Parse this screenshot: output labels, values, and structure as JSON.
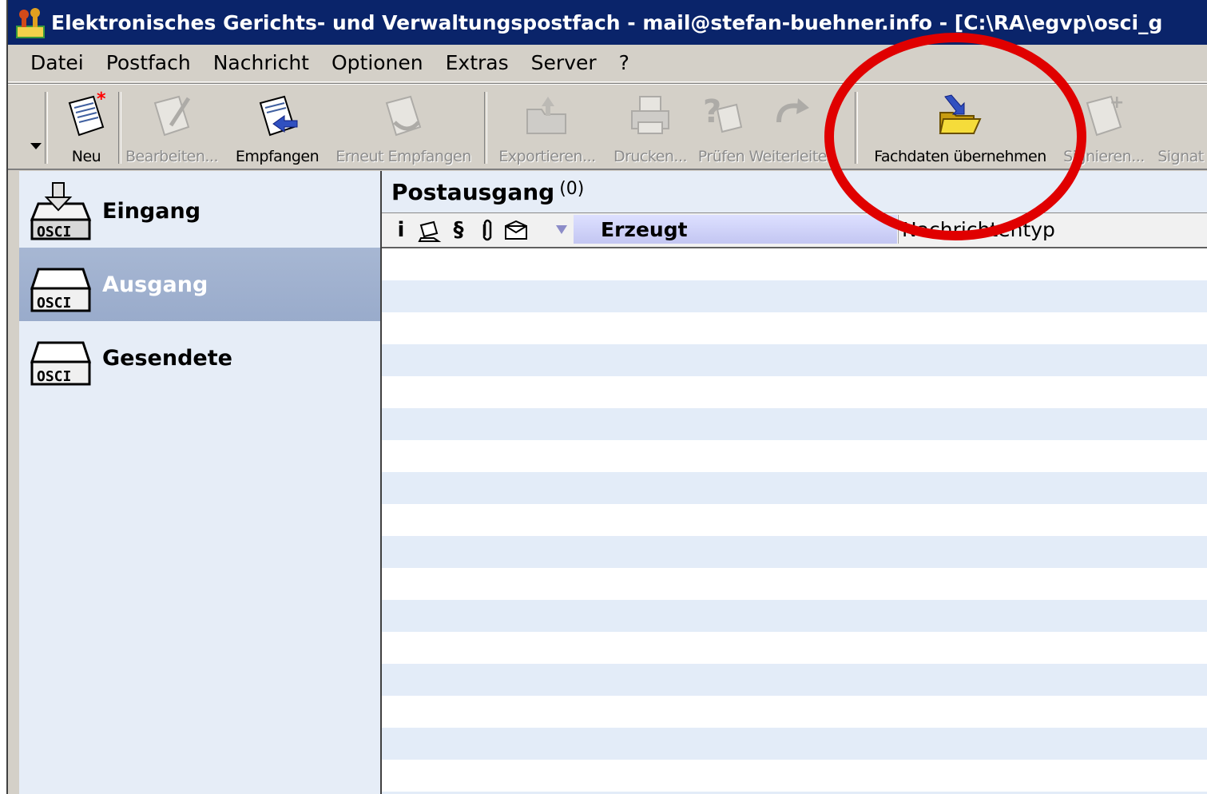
{
  "window": {
    "title": "Elektronisches Gerichts- und Verwaltungspostfach - mail@stefan-buehner.info - [C:\\RA\\egvp\\osci_g"
  },
  "menu": [
    {
      "label": "Datei"
    },
    {
      "label": "Postfach"
    },
    {
      "label": "Nachricht"
    },
    {
      "label": "Optionen"
    },
    {
      "label": "Extras"
    },
    {
      "label": "Server"
    },
    {
      "label": "?"
    }
  ],
  "toolbar": {
    "neu": "Neu",
    "bearbeiten": "Bearbeiten...",
    "empfangen": "Empfangen",
    "erneut": "Erneut Empfangen",
    "exportieren": "Exportieren...",
    "drucken": "Drucken...",
    "pruefen": "Prüfen",
    "weiterleiten": "Weiterleiten",
    "fachdaten": "Fachdaten übernehmen",
    "signieren": "Signieren...",
    "signatur": "Signat"
  },
  "sidebar": {
    "items": [
      {
        "label": "Eingang",
        "badge": "OSCI"
      },
      {
        "label": "Ausgang",
        "badge": "OSCI"
      },
      {
        "label": "Gesendete",
        "badge": "OSCI"
      }
    ]
  },
  "main": {
    "title": "Postausgang",
    "count": "(0)",
    "columns": {
      "info": "i",
      "paragraph": "§",
      "erzeugt": "Erzeugt",
      "nachrichtentyp": "Nachrichtentyp"
    }
  },
  "colors": {
    "titlebar": "#0a246a",
    "selected": "#a7b7d3",
    "annotation": "#e00000"
  }
}
